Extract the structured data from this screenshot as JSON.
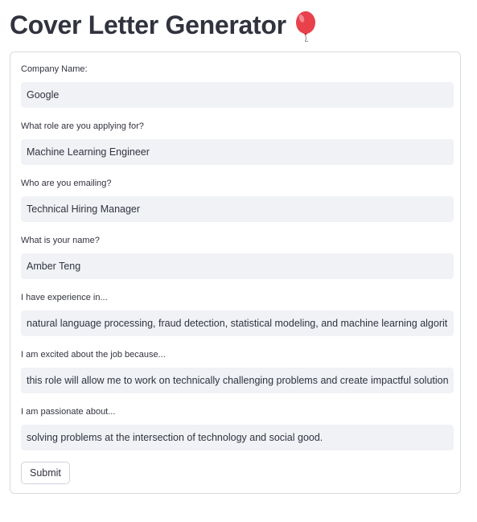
{
  "header": {
    "title": "Cover Letter Generator"
  },
  "form": {
    "fields": [
      {
        "label": "Company Name:",
        "value": "Google"
      },
      {
        "label": "What role are you applying for?",
        "value": "Machine Learning Engineer"
      },
      {
        "label": "Who are you emailing?",
        "value": "Technical Hiring Manager"
      },
      {
        "label": "What is your name?",
        "value": "Amber Teng"
      },
      {
        "label": "I have experience in...",
        "value": "natural language processing, fraud detection, statistical modeling, and machine learning algorithms"
      },
      {
        "label": "I am excited about the job because...",
        "value": "this role will allow me to work on technically challenging problems and create impactful solutions while"
      },
      {
        "label": "I am passionate about...",
        "value": "solving problems at the intersection of technology and social good."
      }
    ],
    "submit_label": "Submit"
  },
  "icons": {
    "title_icon": "balloon-icon"
  },
  "colors": {
    "text": "#31333f",
    "input_background": "#f0f2f6",
    "border": "#d9dbe0",
    "balloon": "#e8414c"
  }
}
